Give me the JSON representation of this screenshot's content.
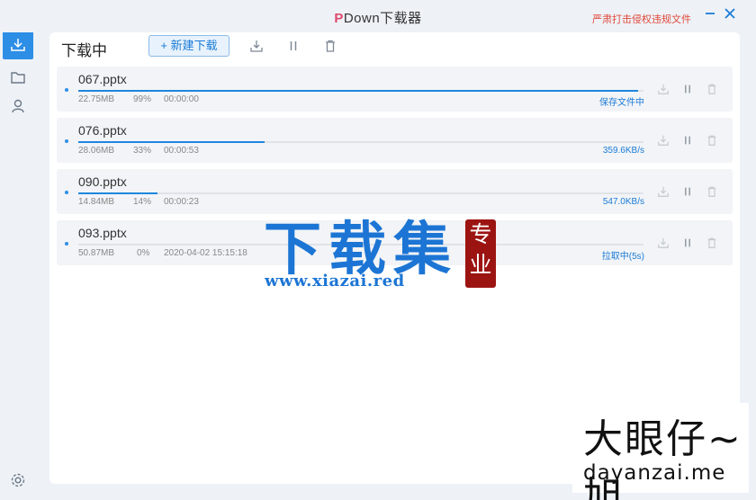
{
  "app": {
    "title_p": "P",
    "title_rest": "Down下载器",
    "notice": "严肃打击侵权违规文件"
  },
  "window_controls": {
    "minimize_icon": "minimize-icon",
    "close_icon": "close-icon"
  },
  "sidebar": {
    "items": [
      {
        "icon": "home-icon",
        "active": false
      },
      {
        "icon": "download-icon",
        "active": true
      },
      {
        "icon": "folder-icon",
        "active": false
      },
      {
        "icon": "user-icon",
        "active": false
      }
    ],
    "settings_icon": "gear-icon"
  },
  "toolbar": {
    "heading": "下载中",
    "new_download_label": "+ 新建下载"
  },
  "downloads": [
    {
      "name": "067.pptx",
      "size": "22.75MB",
      "percent": "99%",
      "time": "00:00:00",
      "status": "保存文件中",
      "progress": 0.99
    },
    {
      "name": "076.pptx",
      "size": "28.06MB",
      "percent": "33%",
      "time": "00:00:53",
      "status": "359.6KB/s",
      "progress": 0.33
    },
    {
      "name": "090.pptx",
      "size": "14.84MB",
      "percent": "14%",
      "time": "00:00:23",
      "status": "547.0KB/s",
      "progress": 0.14
    },
    {
      "name": "093.pptx",
      "size": "50.87MB",
      "percent": "0%",
      "time": "2020-04-02 15:15:18",
      "status": "拉取中(5s)",
      "progress": 0.0
    }
  ],
  "watermark": {
    "main_text": "下载集",
    "seal_line1": "专",
    "seal_line2": "业",
    "url": "www.xiazai.red",
    "brand2_text": "大眼仔~旭",
    "brand2_url": "dayanzai.me"
  },
  "colors": {
    "accent": "#2d8ee6",
    "notice": "#e0483a",
    "title_p": "#e0486b",
    "watermark": "#1c75d4",
    "seal": "#9c1412"
  }
}
